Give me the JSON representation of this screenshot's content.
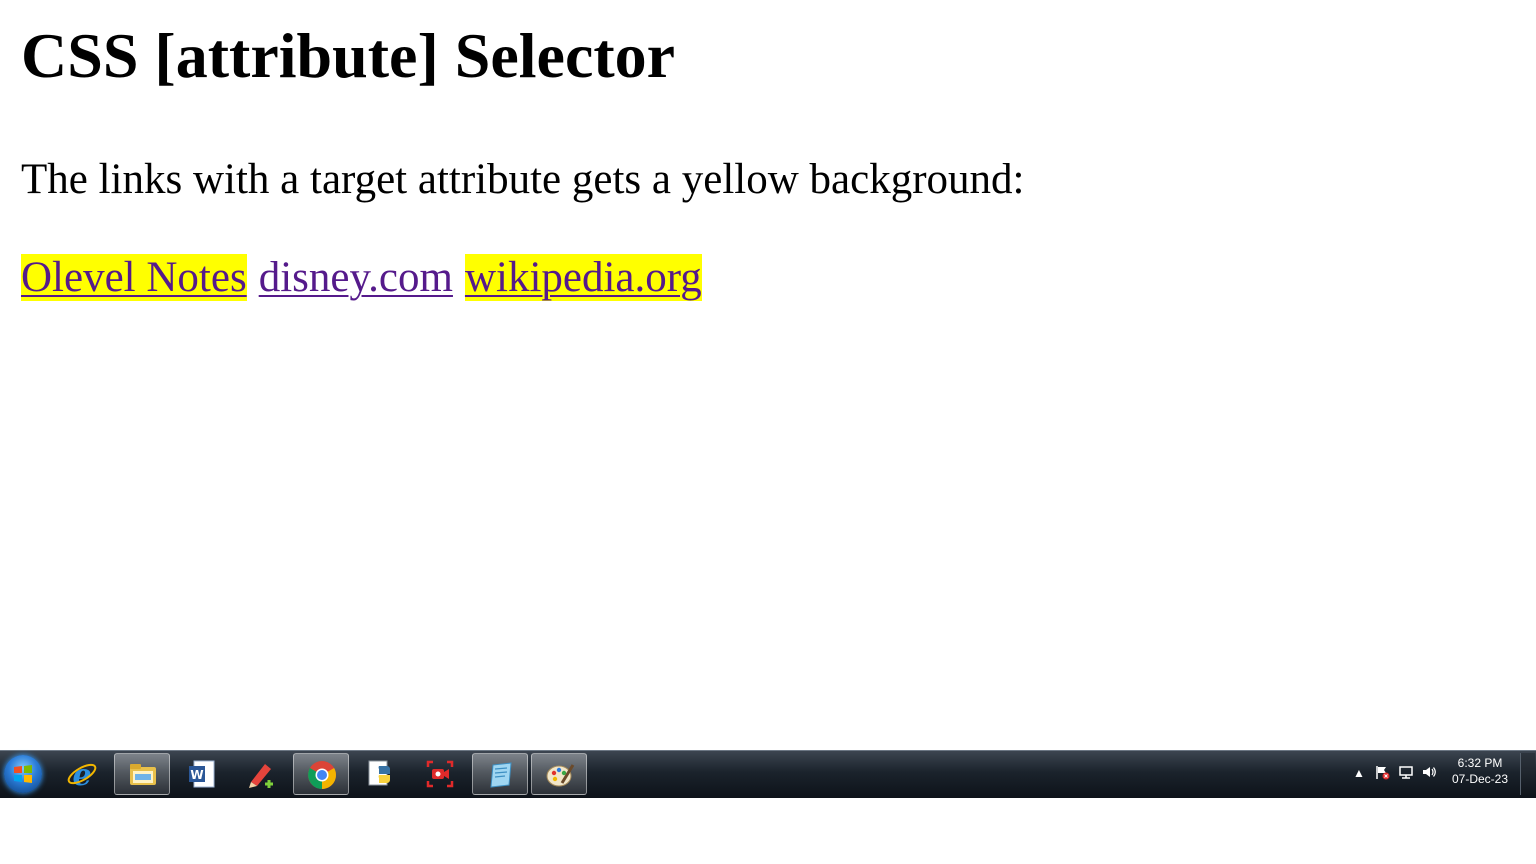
{
  "page": {
    "title": "CSS [attribute] Selector",
    "description": "The links with a target attribute gets a yellow background:",
    "links": [
      {
        "text": "Olevel Notes",
        "highlighted": true
      },
      {
        "text": "disney.com",
        "highlighted": false
      },
      {
        "text": "wikipedia.org",
        "highlighted": true
      }
    ],
    "colors": {
      "highlight": "#ffff00",
      "link": "#551a8b"
    }
  },
  "taskbar": {
    "start_icon": "windows-start-icon",
    "apps": [
      {
        "icon": "internet-explorer-icon",
        "active": false
      },
      {
        "icon": "file-explorer-icon",
        "active": true
      },
      {
        "icon": "word-icon",
        "active": false
      },
      {
        "icon": "pencil-app-icon",
        "active": false
      },
      {
        "icon": "chrome-icon",
        "active": true
      },
      {
        "icon": "python-icon",
        "active": false
      },
      {
        "icon": "screen-recorder-icon",
        "active": false
      },
      {
        "icon": "notepad-icon",
        "active": true
      },
      {
        "icon": "paint-icon",
        "active": true
      }
    ],
    "tray": {
      "time": "6:32 PM",
      "date": "07-Dec-23"
    }
  }
}
